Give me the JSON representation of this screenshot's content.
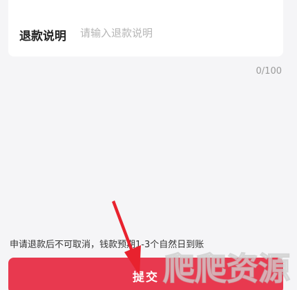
{
  "refund_form": {
    "explanation_label": "退款说明",
    "explanation_placeholder": "请输入退款说明",
    "explanation_value": "",
    "char_counter": "0/100"
  },
  "notice": {
    "text": "申请退款后不可取消，钱款预期1-3个自然日到账"
  },
  "actions": {
    "submit_label": "提交"
  },
  "watermark": {
    "text": "爬爬资源"
  },
  "colors": {
    "accent": "#e8394f",
    "background": "#f5f5f7",
    "card": "#ffffff",
    "arrow": "#e8222e"
  }
}
